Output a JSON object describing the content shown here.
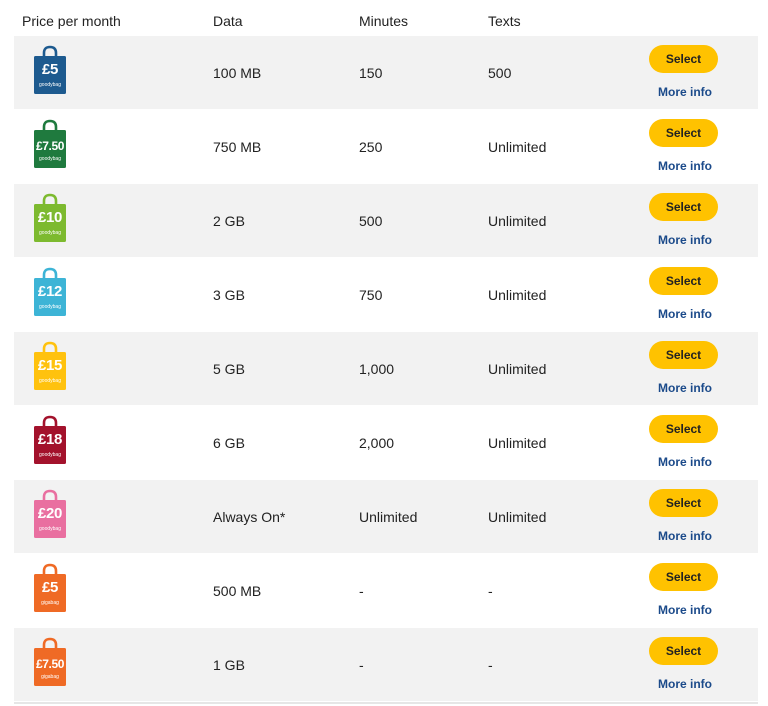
{
  "table": {
    "headers": {
      "price": "Price per month",
      "data": "Data",
      "minutes": "Minutes",
      "texts": "Texts"
    },
    "select_label": "Select",
    "more_info_label": "More info",
    "plans": [
      {
        "amount": "£5",
        "brand": "goodybag",
        "color": "#1d5a8f",
        "data": "100 MB",
        "minutes": "150",
        "texts": "500"
      },
      {
        "amount": "£7.50",
        "brand": "goodybag",
        "color": "#1f7a3e",
        "data": "750 MB",
        "minutes": "250",
        "texts": "Unlimited"
      },
      {
        "amount": "£10",
        "brand": "goodybag",
        "color": "#7dba2f",
        "data": "2 GB",
        "minutes": "500",
        "texts": "Unlimited"
      },
      {
        "amount": "£12",
        "brand": "goodybag",
        "color": "#3db4d6",
        "data": "3 GB",
        "minutes": "750",
        "texts": "Unlimited"
      },
      {
        "amount": "£15",
        "brand": "goodybag",
        "color": "#ffc20e",
        "data": "5 GB",
        "minutes": "1,000",
        "texts": "Unlimited"
      },
      {
        "amount": "£18",
        "brand": "goodybag",
        "color": "#a3122c",
        "data": "6 GB",
        "minutes": "2,000",
        "texts": "Unlimited"
      },
      {
        "amount": "£20",
        "brand": "goodybag",
        "color": "#e96fa0",
        "data": "Always On*",
        "minutes": "Unlimited",
        "texts": "Unlimited"
      },
      {
        "amount": "£5",
        "brand": "gigabag",
        "color": "#ef6a25",
        "data": "500 MB",
        "minutes": "-",
        "texts": "-"
      },
      {
        "amount": "£7.50",
        "brand": "gigabag",
        "color": "#ef6a25",
        "data": "1 GB",
        "minutes": "-",
        "texts": "-"
      }
    ]
  }
}
